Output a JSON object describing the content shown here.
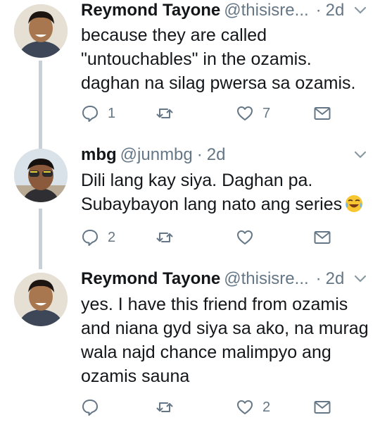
{
  "tweets": [
    {
      "name": "Reymond Tayone",
      "handle": "@thisisre...",
      "sep": "·",
      "time": "2d",
      "lines": [
        "because they are called",
        "\"untouchables\" in the ozamis.",
        "daghan na silag pwersa sa ozamis."
      ],
      "reply_count": "1",
      "retweet_count": "",
      "like_count": "7"
    },
    {
      "name": "mbg",
      "handle": "@junmbg",
      "sep": "·",
      "time": "2d",
      "lines": [
        "Dili lang kay siya. Daghan pa.",
        "Subaybayon lang nato ang series"
      ],
      "reply_count": "2",
      "retweet_count": "",
      "like_count": ""
    },
    {
      "name": "Reymond Tayone",
      "handle": "@thisisre...",
      "sep": "·",
      "time": "2d",
      "lines": [
        "yes. I have this friend from ozamis",
        "and niana gyd siya sa ako, na murag",
        "wala najd chance malimpyo ang",
        "ozamis sauna"
      ],
      "reply_count": "",
      "retweet_count": "",
      "like_count": "2"
    }
  ],
  "icons": {
    "reply": "reply-icon",
    "retweet": "retweet-icon",
    "like": "heart-icon",
    "share": "envelope-icon",
    "caret": "chevron-down-icon",
    "emoji": "face-with-tears-of-joy-emoji"
  },
  "colors": {
    "text": "#14171a",
    "secondary": "#657786",
    "thread_line": "#c7d0d8"
  }
}
